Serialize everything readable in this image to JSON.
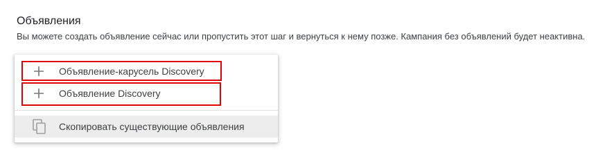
{
  "section": {
    "title": "Объявления",
    "description": "Вы можете создать объявление сейчас или пропустить этот шаг и вернуться к нему позже. Кампания без объявлений будет неактивна."
  },
  "menu": {
    "items": [
      {
        "label": "Объявление-карусель Discovery",
        "icon": "plus-icon"
      },
      {
        "label": "Объявление Discovery",
        "icon": "plus-icon"
      },
      {
        "label": "Скопировать существующие объявления",
        "icon": "copy-icon"
      }
    ]
  },
  "colors": {
    "highlight": "#e00000",
    "text": "#3c4043",
    "hover_bg": "#ededed"
  }
}
